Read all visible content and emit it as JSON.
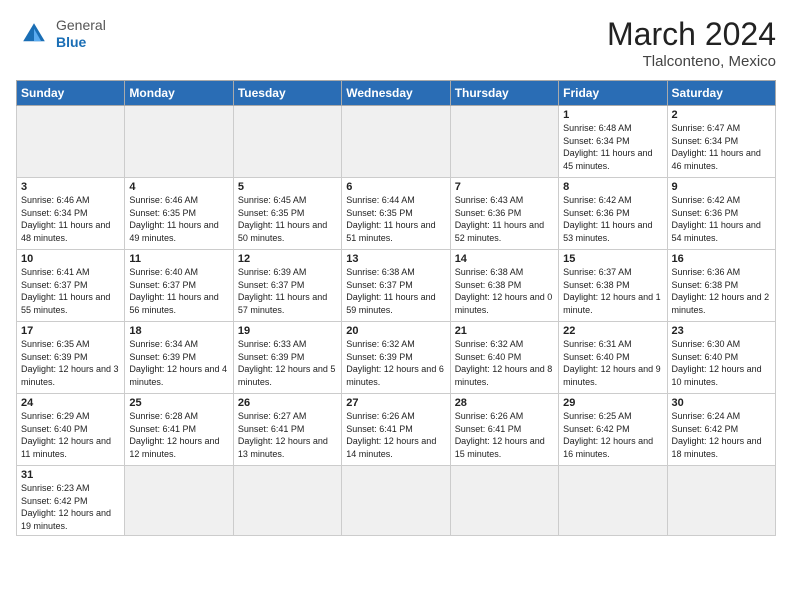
{
  "header": {
    "logo_general": "General",
    "logo_blue": "Blue",
    "month_year": "March 2024",
    "location": "Tlalconteno, Mexico"
  },
  "days_of_week": [
    "Sunday",
    "Monday",
    "Tuesday",
    "Wednesday",
    "Thursday",
    "Friday",
    "Saturday"
  ],
  "weeks": [
    [
      {
        "day": "",
        "info": "",
        "empty": true
      },
      {
        "day": "",
        "info": "",
        "empty": true
      },
      {
        "day": "",
        "info": "",
        "empty": true
      },
      {
        "day": "",
        "info": "",
        "empty": true
      },
      {
        "day": "",
        "info": "",
        "empty": true
      },
      {
        "day": "1",
        "info": "Sunrise: 6:48 AM\nSunset: 6:34 PM\nDaylight: 11 hours and 45 minutes."
      },
      {
        "day": "2",
        "info": "Sunrise: 6:47 AM\nSunset: 6:34 PM\nDaylight: 11 hours and 46 minutes."
      }
    ],
    [
      {
        "day": "3",
        "info": "Sunrise: 6:46 AM\nSunset: 6:34 PM\nDaylight: 11 hours and 48 minutes."
      },
      {
        "day": "4",
        "info": "Sunrise: 6:46 AM\nSunset: 6:35 PM\nDaylight: 11 hours and 49 minutes."
      },
      {
        "day": "5",
        "info": "Sunrise: 6:45 AM\nSunset: 6:35 PM\nDaylight: 11 hours and 50 minutes."
      },
      {
        "day": "6",
        "info": "Sunrise: 6:44 AM\nSunset: 6:35 PM\nDaylight: 11 hours and 51 minutes."
      },
      {
        "day": "7",
        "info": "Sunrise: 6:43 AM\nSunset: 6:36 PM\nDaylight: 11 hours and 52 minutes."
      },
      {
        "day": "8",
        "info": "Sunrise: 6:42 AM\nSunset: 6:36 PM\nDaylight: 11 hours and 53 minutes."
      },
      {
        "day": "9",
        "info": "Sunrise: 6:42 AM\nSunset: 6:36 PM\nDaylight: 11 hours and 54 minutes."
      }
    ],
    [
      {
        "day": "10",
        "info": "Sunrise: 6:41 AM\nSunset: 6:37 PM\nDaylight: 11 hours and 55 minutes."
      },
      {
        "day": "11",
        "info": "Sunrise: 6:40 AM\nSunset: 6:37 PM\nDaylight: 11 hours and 56 minutes."
      },
      {
        "day": "12",
        "info": "Sunrise: 6:39 AM\nSunset: 6:37 PM\nDaylight: 11 hours and 57 minutes."
      },
      {
        "day": "13",
        "info": "Sunrise: 6:38 AM\nSunset: 6:37 PM\nDaylight: 11 hours and 59 minutes."
      },
      {
        "day": "14",
        "info": "Sunrise: 6:38 AM\nSunset: 6:38 PM\nDaylight: 12 hours and 0 minutes."
      },
      {
        "day": "15",
        "info": "Sunrise: 6:37 AM\nSunset: 6:38 PM\nDaylight: 12 hours and 1 minute."
      },
      {
        "day": "16",
        "info": "Sunrise: 6:36 AM\nSunset: 6:38 PM\nDaylight: 12 hours and 2 minutes."
      }
    ],
    [
      {
        "day": "17",
        "info": "Sunrise: 6:35 AM\nSunset: 6:39 PM\nDaylight: 12 hours and 3 minutes."
      },
      {
        "day": "18",
        "info": "Sunrise: 6:34 AM\nSunset: 6:39 PM\nDaylight: 12 hours and 4 minutes."
      },
      {
        "day": "19",
        "info": "Sunrise: 6:33 AM\nSunset: 6:39 PM\nDaylight: 12 hours and 5 minutes."
      },
      {
        "day": "20",
        "info": "Sunrise: 6:32 AM\nSunset: 6:39 PM\nDaylight: 12 hours and 6 minutes."
      },
      {
        "day": "21",
        "info": "Sunrise: 6:32 AM\nSunset: 6:40 PM\nDaylight: 12 hours and 8 minutes."
      },
      {
        "day": "22",
        "info": "Sunrise: 6:31 AM\nSunset: 6:40 PM\nDaylight: 12 hours and 9 minutes."
      },
      {
        "day": "23",
        "info": "Sunrise: 6:30 AM\nSunset: 6:40 PM\nDaylight: 12 hours and 10 minutes."
      }
    ],
    [
      {
        "day": "24",
        "info": "Sunrise: 6:29 AM\nSunset: 6:40 PM\nDaylight: 12 hours and 11 minutes."
      },
      {
        "day": "25",
        "info": "Sunrise: 6:28 AM\nSunset: 6:41 PM\nDaylight: 12 hours and 12 minutes."
      },
      {
        "day": "26",
        "info": "Sunrise: 6:27 AM\nSunset: 6:41 PM\nDaylight: 12 hours and 13 minutes."
      },
      {
        "day": "27",
        "info": "Sunrise: 6:26 AM\nSunset: 6:41 PM\nDaylight: 12 hours and 14 minutes."
      },
      {
        "day": "28",
        "info": "Sunrise: 6:26 AM\nSunset: 6:41 PM\nDaylight: 12 hours and 15 minutes."
      },
      {
        "day": "29",
        "info": "Sunrise: 6:25 AM\nSunset: 6:42 PM\nDaylight: 12 hours and 16 minutes."
      },
      {
        "day": "30",
        "info": "Sunrise: 6:24 AM\nSunset: 6:42 PM\nDaylight: 12 hours and 18 minutes."
      }
    ],
    [
      {
        "day": "31",
        "info": "Sunrise: 6:23 AM\nSunset: 6:42 PM\nDaylight: 12 hours and 19 minutes."
      },
      {
        "day": "",
        "info": "",
        "empty": true
      },
      {
        "day": "",
        "info": "",
        "empty": true
      },
      {
        "day": "",
        "info": "",
        "empty": true
      },
      {
        "day": "",
        "info": "",
        "empty": true
      },
      {
        "day": "",
        "info": "",
        "empty": true
      },
      {
        "day": "",
        "info": "",
        "empty": true
      }
    ]
  ]
}
